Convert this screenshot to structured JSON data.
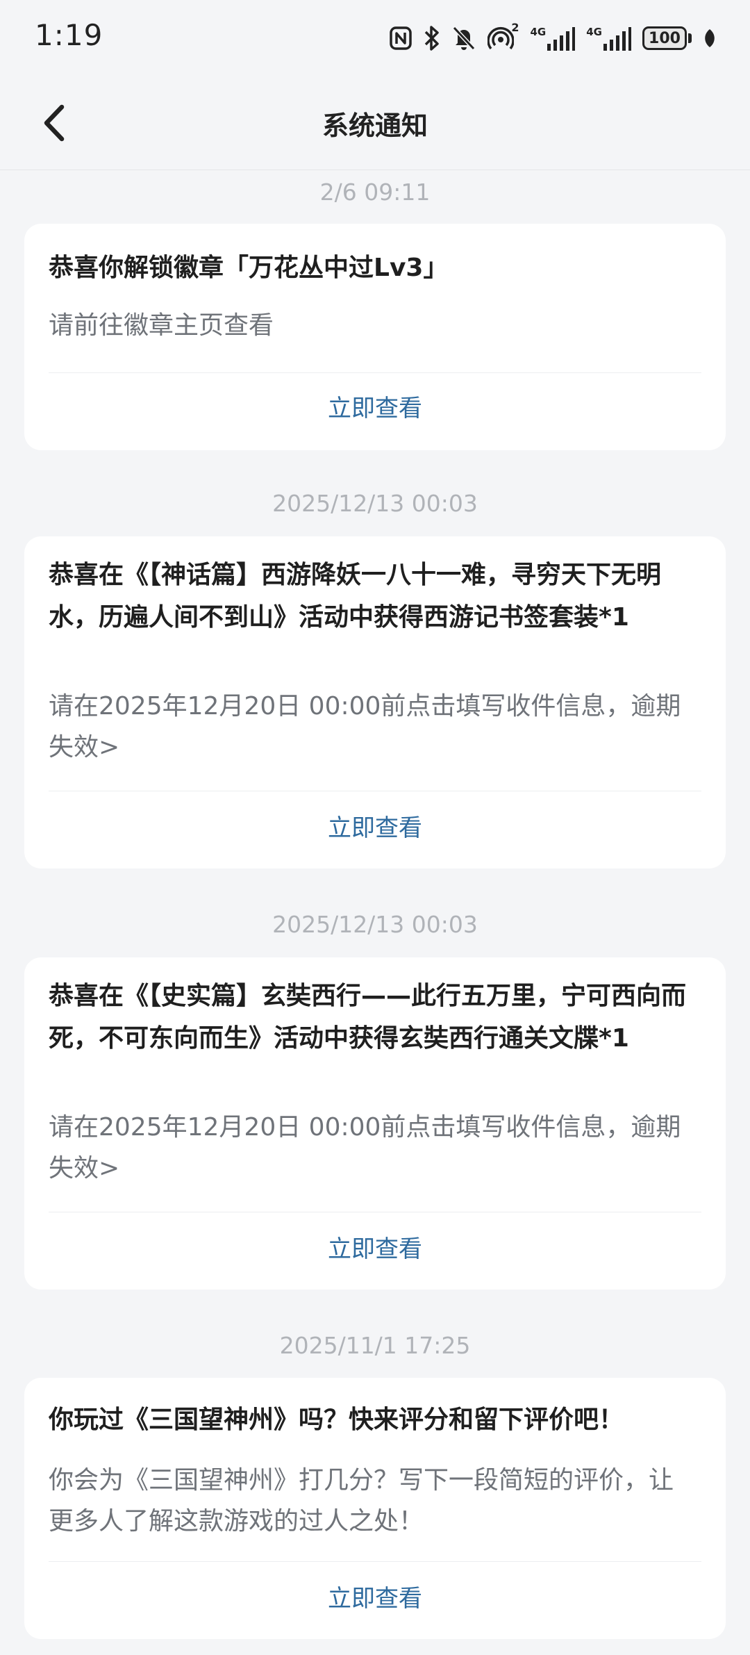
{
  "status_bar": {
    "time": "1:19",
    "battery": "100",
    "icons": [
      "nfc-icon",
      "bluetooth-icon",
      "mute-icon",
      "hotspot-icon",
      "signal-4g-icon",
      "signal-4g-icon",
      "battery-icon",
      "leaf-icon"
    ],
    "hotspot_badge": "2",
    "network_label": "4G"
  },
  "nav": {
    "title": "系统通知"
  },
  "notifications": [
    {
      "timestamp": "2/6  09:11",
      "title": "恭喜你解锁徽章「万花丛中过Lv3」",
      "desc": "请前往徽章主页查看",
      "action": "立即查看"
    },
    {
      "timestamp": "2025/12/13  00:03",
      "title": "恭喜在《【神话篇】西游降妖一八十一难，寻穷天下无明水，历遍人间不到山》活动中获得西游记书签套装*1",
      "desc": "请在2025年12月20日 00:00前点击填写收件信息，逾期失效>",
      "action": "立即查看"
    },
    {
      "timestamp": "2025/12/13  00:03",
      "title": "恭喜在《【史实篇】玄奘西行——此行五万里，宁可西向而死，不可东向而生》活动中获得玄奘西行通关文牒*1",
      "desc": "请在2025年12月20日 00:00前点击填写收件信息，逾期失效>",
      "action": "立即查看"
    },
    {
      "timestamp": "2025/11/1  17:25",
      "title": "你玩过《三国望神州》吗？快来评分和留下评价吧！",
      "desc": "你会为《三国望神州》打几分？写下一段简短的评价，让更多人了解这款游戏的过人之处！",
      "action": "立即查看"
    }
  ],
  "colors": {
    "background": "#f4f5f7",
    "card": "#ffffff",
    "action": "#2e6a9e",
    "timestamp": "#b0b3b8",
    "desc": "#6f7379"
  }
}
